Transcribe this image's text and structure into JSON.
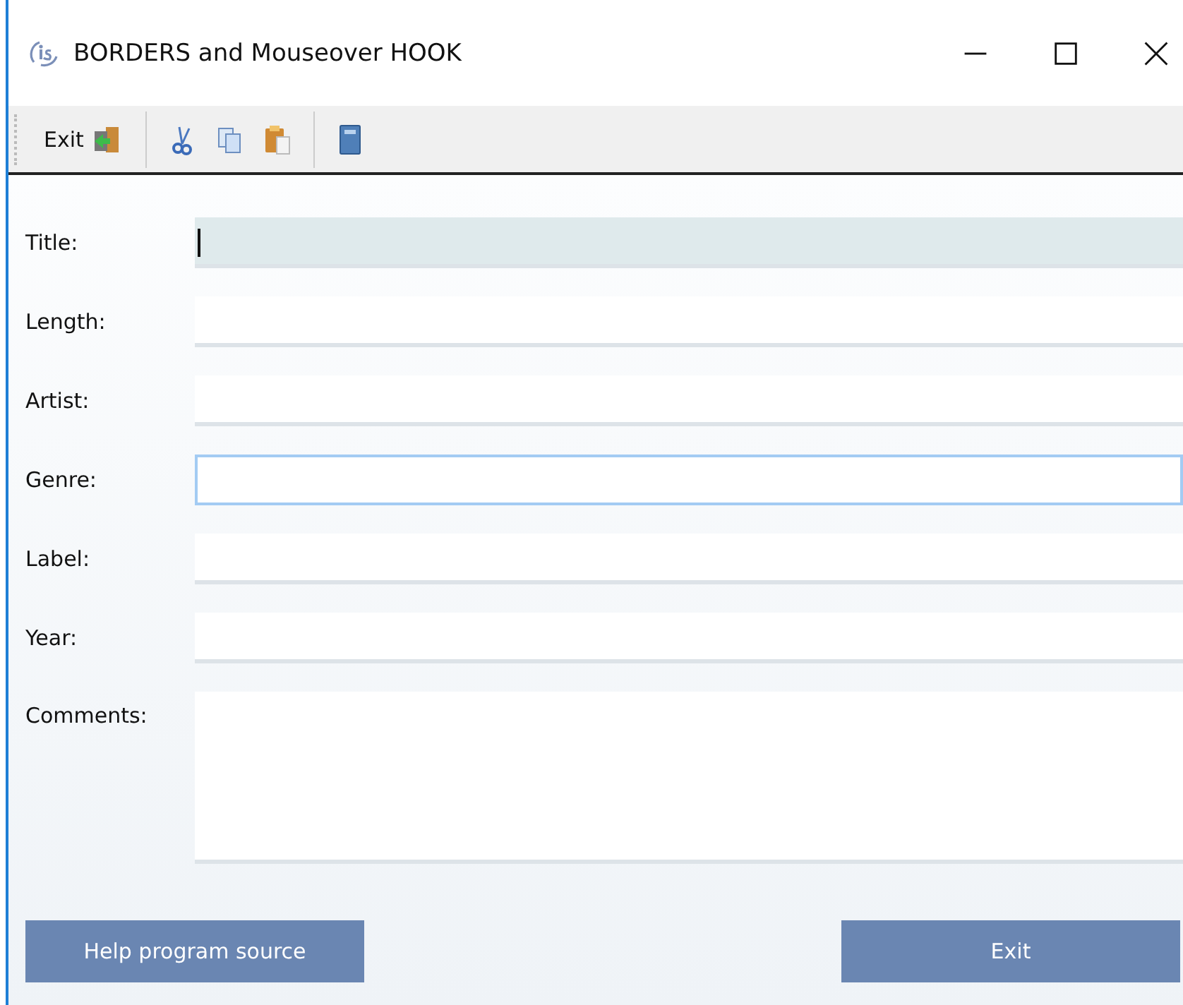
{
  "window": {
    "title": "BORDERS and Mouseover HOOK"
  },
  "toolbar": {
    "exit_label": "Exit"
  },
  "fields": [
    {
      "label": "Title:",
      "kind": "line",
      "focused": true,
      "hovered": false
    },
    {
      "label": "Length:",
      "kind": "line",
      "focused": false,
      "hovered": false
    },
    {
      "label": "Artist:",
      "kind": "line",
      "focused": false,
      "hovered": false
    },
    {
      "label": "Genre:",
      "kind": "line",
      "focused": false,
      "hovered": true
    },
    {
      "label": "Label:",
      "kind": "line",
      "focused": false,
      "hovered": false
    },
    {
      "label": "Year:",
      "kind": "line",
      "focused": false,
      "hovered": false
    },
    {
      "label": "Comments:",
      "kind": "memo",
      "focused": false,
      "hovered": false
    }
  ],
  "buttons": [
    "Help program source",
    "Exit"
  ]
}
